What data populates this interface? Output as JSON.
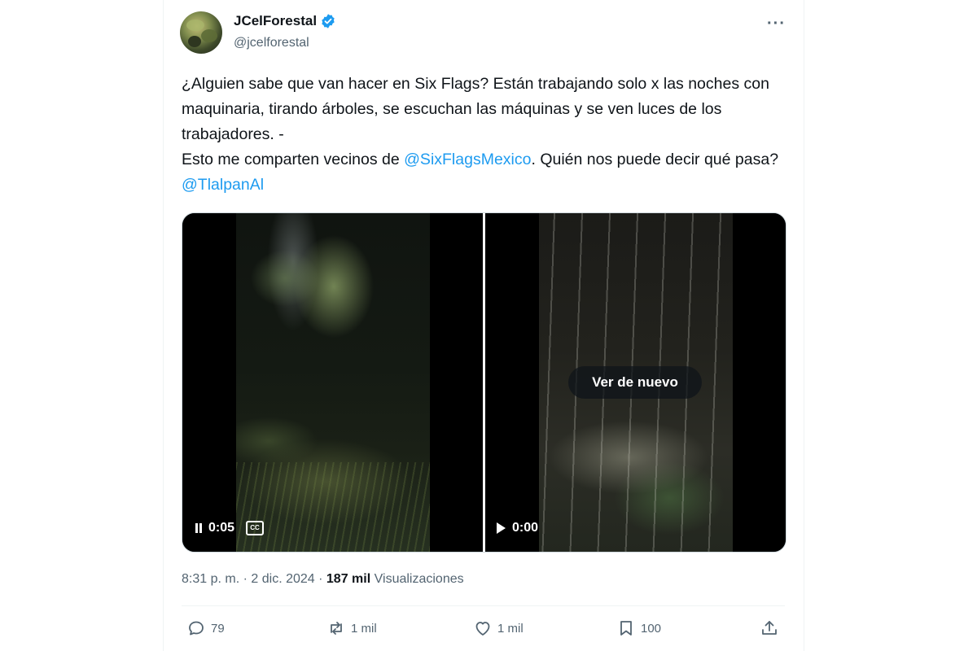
{
  "user": {
    "display_name": "JCelForestal",
    "handle": "@jcelforestal",
    "verified_icon": "verified-badge-icon"
  },
  "tweet": {
    "line1": "¿Alguien sabe que van hacer en Six Flags?  Están trabajando solo x las noches con maquinaria, tirando árboles, se escuchan las máquinas y se ven luces de los trabajadores. -",
    "line2_prefix": "Esto me comparten vecinos de ",
    "mention1": "@SixFlagsMexico",
    "line2_middle": ". Quién nos puede decir qué pasa? ",
    "mention2": "@TlalpanAl"
  },
  "media": {
    "video1": {
      "time": "0:05",
      "state": "playing",
      "cc_label": "CC"
    },
    "video2": {
      "time": "0:00",
      "state": "ended",
      "replay_label": "Ver de nuevo"
    }
  },
  "meta": {
    "time": "8:31 p. m.",
    "date": "2 dic. 2024",
    "views_count": "187 mil",
    "views_label": "Visualizaciones",
    "separator": "·"
  },
  "actions": {
    "replies": "79",
    "reposts": "1 mil",
    "likes": "1 mil",
    "bookmarks": "100"
  },
  "colors": {
    "link": "#1d9bf0",
    "text": "#0f1419",
    "secondary": "#536471"
  }
}
